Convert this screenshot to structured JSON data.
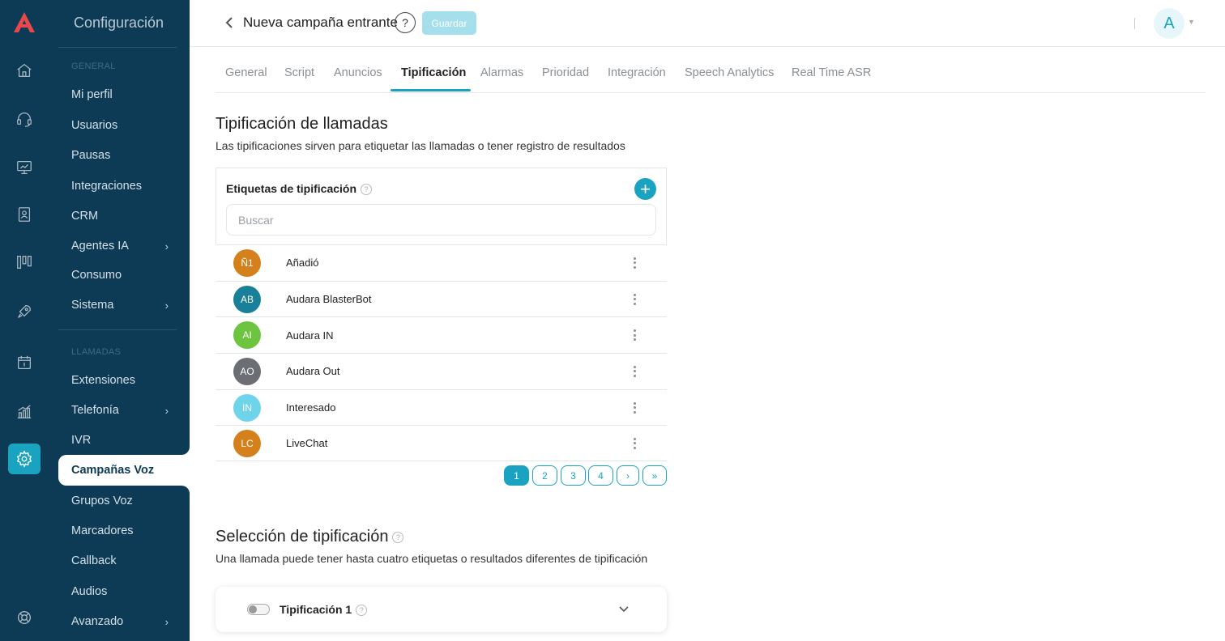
{
  "sidebar": {
    "title": "Configuración",
    "section_general": "GENERAL",
    "section_calls": "LLAMADAS",
    "items_general": [
      {
        "label": "Mi perfil",
        "chevron": ""
      },
      {
        "label": "Usuarios",
        "chevron": ""
      },
      {
        "label": "Pausas",
        "chevron": ""
      },
      {
        "label": "Integraciones",
        "chevron": ""
      },
      {
        "label": "CRM",
        "chevron": ""
      },
      {
        "label": "Agentes IA",
        "chevron": "›"
      },
      {
        "label": "Consumo",
        "chevron": ""
      },
      {
        "label": "Sistema",
        "chevron": "›"
      }
    ],
    "items_calls": [
      {
        "label": "Extensiones",
        "chevron": ""
      },
      {
        "label": "Telefonía",
        "chevron": "›"
      },
      {
        "label": "IVR",
        "chevron": ""
      }
    ],
    "active_item": "Campañas Voz",
    "items_after": [
      {
        "label": "Grupos Voz",
        "chevron": ""
      },
      {
        "label": "Marcadores",
        "chevron": ""
      },
      {
        "label": "Callback",
        "chevron": ""
      },
      {
        "label": "Audios",
        "chevron": ""
      },
      {
        "label": "Avanzado",
        "chevron": "›"
      }
    ]
  },
  "header": {
    "title": "Nueva campaña entrante",
    "help": "?",
    "save_label": "Guardar",
    "avatar_initial": "A"
  },
  "tabs": [
    "General",
    "Script",
    "Anuncios",
    "Tipificación",
    "Alarmas",
    "Prioridad",
    "Integración",
    "Speech Analytics",
    "Real Time ASR"
  ],
  "active_tab": "Tipificación",
  "typing_section": {
    "title": "Tipificación de llamadas",
    "subtitle": "Las tipificaciones sirven para etiquetar las llamadas o tener registro de resultados",
    "card_title": "Etiquetas de tipificación",
    "search_placeholder": "Buscar",
    "tags": [
      {
        "initials": "Ñ1",
        "label": "Añadió",
        "color": "#d4801c"
      },
      {
        "initials": "AB",
        "label": "Audara BlasterBot",
        "color": "#1a7f98"
      },
      {
        "initials": "AI",
        "label": "Audara IN",
        "color": "#6cc43f"
      },
      {
        "initials": "AO",
        "label": "Audara Out",
        "color": "#6b6f73"
      },
      {
        "initials": "IN",
        "label": "Interesado",
        "color": "#6fd3ea"
      },
      {
        "initials": "LC",
        "label": "LiveChat",
        "color": "#d4801c"
      }
    ],
    "pagination": [
      "1",
      "2",
      "3",
      "4",
      "›",
      "»"
    ],
    "current_page": "1"
  },
  "selection_section": {
    "title": "Selección de tipificación",
    "subtitle": "Una llamada puede tener hasta cuatro etiquetas o resultados diferentes de tipificación",
    "accordion_title": "Tipificación 1"
  },
  "colors": {
    "sidebar_bg": "#0d3a55",
    "accent": "#1aa3c0",
    "brand_logo": "#e8474c"
  }
}
